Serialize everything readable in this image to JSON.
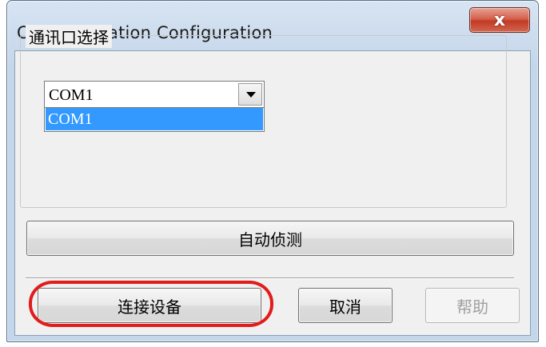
{
  "window": {
    "title": "Communication Configuration",
    "close_glyph": "x"
  },
  "port_group": {
    "title": "通讯口选择",
    "combo_value": "COM1",
    "dropdown_items": [
      "COM1"
    ]
  },
  "buttons": {
    "auto_detect": "自动侦测",
    "connect": "连接设备",
    "cancel": "取消",
    "help": "帮助"
  },
  "colors": {
    "selection": "#3399ff",
    "highlight_ellipse": "#e21b1b",
    "close_button": "#c23b24"
  },
  "icons": {
    "close": "close-icon",
    "dropdown_arrow": "chevron-down-icon"
  }
}
